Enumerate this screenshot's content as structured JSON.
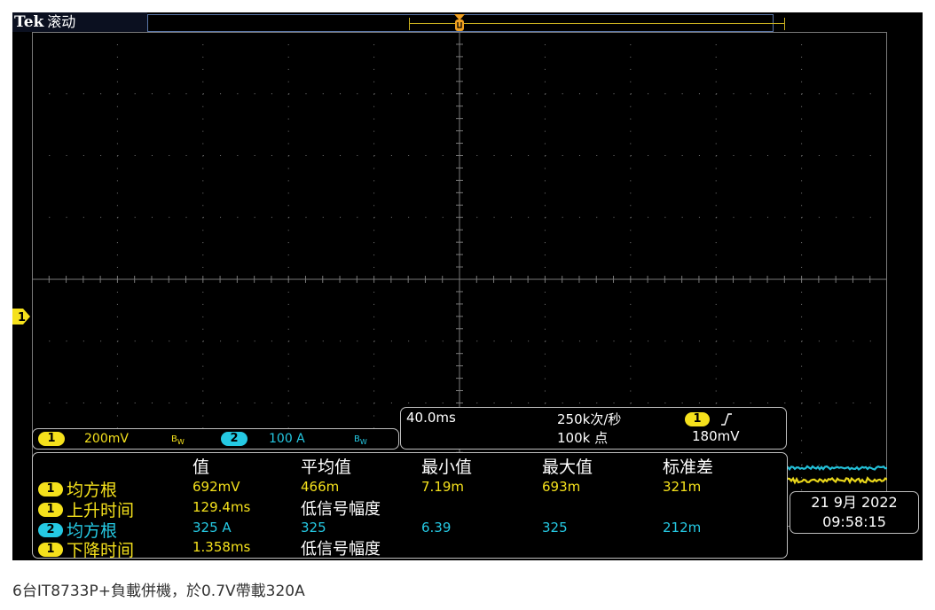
{
  "header": {
    "brand": "Tek",
    "mode": "滚动"
  },
  "channels": [
    {
      "id": "1",
      "scale": "200mV",
      "bw_flag": "BW",
      "color": "#f5e11c"
    },
    {
      "id": "2",
      "scale": "100 A",
      "bw_flag": "BW",
      "color": "#25c9e3"
    }
  ],
  "ch1_ground_marker": "1",
  "acquisition": {
    "timebase": "40.0ms",
    "sample_rate": "250k次/秒",
    "record_length": "100k 点",
    "trigger_source": "1",
    "trigger_slope_icon": "rising-edge-icon",
    "trigger_level": "180mV"
  },
  "measurements": {
    "headers": [
      "值",
      "平均值",
      "最小值",
      "最大值",
      "标准差"
    ],
    "rows": [
      {
        "ch": "1",
        "name": "均方根",
        "value": "692mV",
        "mean": "466m",
        "min": "7.19m",
        "max": "693m",
        "std": "321m",
        "note": ""
      },
      {
        "ch": "1",
        "name": "上升时间",
        "value": "129.4ms",
        "mean": "",
        "min": "",
        "max": "",
        "std": "",
        "note": "低信号幅度"
      },
      {
        "ch": "2",
        "name": "均方根",
        "value": "325 A",
        "mean": "325",
        "min": "6.39",
        "max": "325",
        "std": "212m",
        "note": ""
      },
      {
        "ch": "1",
        "name": "下降时间",
        "value": "1.358ms",
        "mean": "",
        "min": "",
        "max": "",
        "std": "",
        "note": "低信号幅度"
      }
    ]
  },
  "datetime": {
    "date": "21 9月 2022",
    "time": "09:58:15"
  },
  "caption": "6台IT8733P+負載併機，於0.7V帶載320A",
  "traces": {
    "ch1_level_div": 3.25,
    "ch2_level_div": 3.05,
    "colors": {
      "ch1": "#f5e11c",
      "ch2": "#25c9e3",
      "grid": "#7a7a7a"
    }
  }
}
